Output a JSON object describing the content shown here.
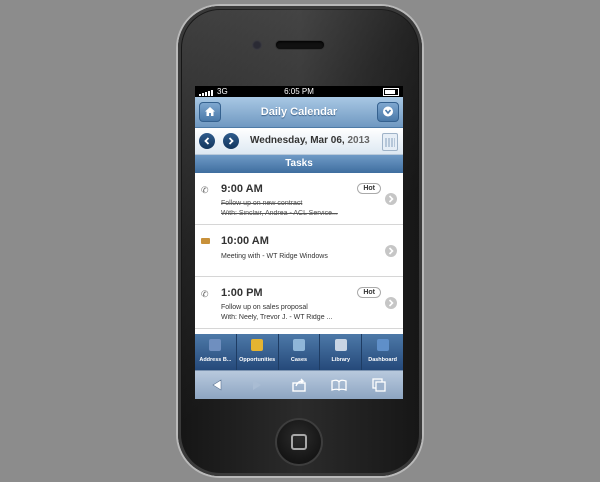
{
  "status": {
    "carrier": "3G",
    "time": "6:05 PM"
  },
  "header": {
    "title": "Daily Calendar"
  },
  "datebar": {
    "day": "Wednesday, Mar 06,",
    "year": "2013"
  },
  "section": {
    "title": "Tasks"
  },
  "tasks": [
    {
      "icon": "phone-icon",
      "time": "9:00 AM",
      "badge": "Hot",
      "line1": "Follow up on new contract",
      "line2": "With: Sinclair, Andrea - ACL Service...",
      "done": true
    },
    {
      "icon": "briefcase-icon",
      "time": "10:00 AM",
      "badge": "",
      "line1": "Meeting with - WT Ridge Windows",
      "line2": "",
      "done": false
    },
    {
      "icon": "phone-icon",
      "time": "1:00 PM",
      "badge": "Hot",
      "line1": "Follow up on sales proposal",
      "line2": "With: Neely, Trevor J. - WT Ridge ...",
      "done": false
    }
  ],
  "tabbar": {
    "tabs": [
      {
        "label": "Address B...",
        "icon": "address-book-icon",
        "color": "#6f8fbf"
      },
      {
        "label": "Opportunities",
        "icon": "opportunities-icon",
        "color": "#e5b431"
      },
      {
        "label": "Cases",
        "icon": "cases-icon",
        "color": "#8fb6d8"
      },
      {
        "label": "Library",
        "icon": "library-icon",
        "color": "#c9d5e4"
      },
      {
        "label": "Dashboard",
        "icon": "dashboard-icon",
        "color": "#5f8fc9"
      }
    ]
  },
  "colors": {
    "accent": "#4a79a9",
    "header": "#6f98c1",
    "tabbar": "#25497a"
  }
}
